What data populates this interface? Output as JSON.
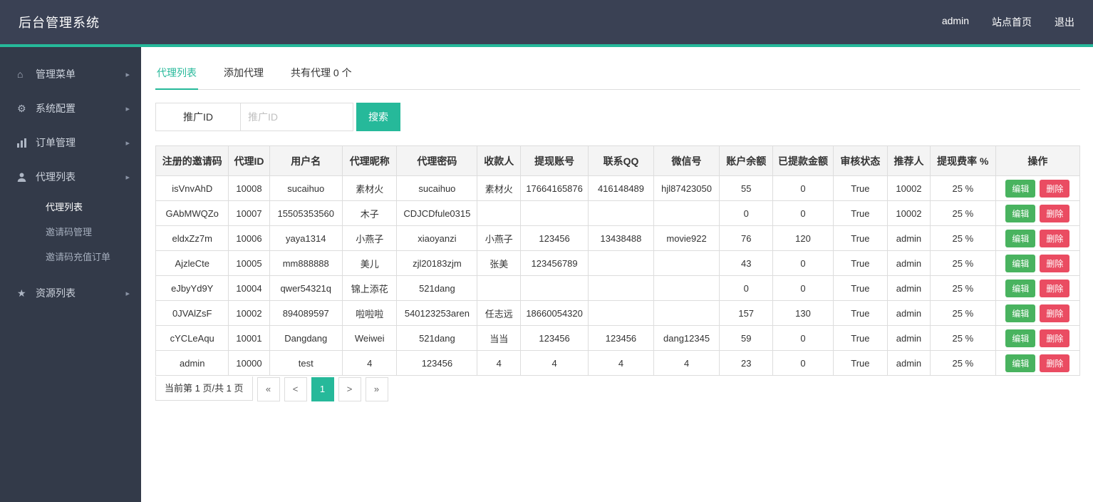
{
  "navbar": {
    "brand": "后台管理系统",
    "links": [
      {
        "label": "admin"
      },
      {
        "label": "站点首页"
      },
      {
        "label": "退出"
      }
    ]
  },
  "sidebar": {
    "items": [
      {
        "id": "admin-menu",
        "icon": "home-icon",
        "label": "管理菜单"
      },
      {
        "id": "system-config",
        "icon": "gears-icon",
        "label": "系统配置"
      },
      {
        "id": "order-management",
        "icon": "bar-chart-icon",
        "label": "订单管理"
      },
      {
        "id": "agent-list",
        "icon": "user-icon",
        "label": "代理列表",
        "children": [
          {
            "label": "代理列表",
            "active": true
          },
          {
            "label": "邀请码管理",
            "active": false
          },
          {
            "label": "邀请码充值订单",
            "active": false
          }
        ]
      },
      {
        "id": "resource-list",
        "icon": "star-icon",
        "label": "资源列表"
      }
    ]
  },
  "tabs": [
    {
      "id": "agent-list",
      "label": "代理列表",
      "active": true,
      "static": false
    },
    {
      "id": "add-agent",
      "label": "添加代理",
      "active": false,
      "static": false
    },
    {
      "id": "agent-count",
      "label": "共有代理 0 个",
      "active": false,
      "static": true
    }
  ],
  "search": {
    "field_label": "推广ID",
    "placeholder": "推广ID",
    "button_label": "搜索"
  },
  "table": {
    "headers": [
      "注册的邀请码",
      "代理ID",
      "用户名",
      "代理昵称",
      "代理密码",
      "收款人",
      "提现账号",
      "联系QQ",
      "微信号",
      "账户余额",
      "已提款金额",
      "审核状态",
      "推荐人",
      "提现费率 %",
      "操作"
    ],
    "rows": [
      [
        "isVnvAhD",
        "10008",
        "sucaihuo",
        "素材火",
        "sucaihuo",
        "素材火",
        "17664165876",
        "416148489",
        "hjl87423050",
        "55",
        "0",
        "True",
        "10002",
        "25 %"
      ],
      [
        "GAbMWQZo",
        "10007",
        "15505353560",
        "木子",
        "CDJCDfule0315",
        "",
        "",
        "",
        "",
        "0",
        "0",
        "True",
        "10002",
        "25 %"
      ],
      [
        "eldxZz7m",
        "10006",
        "yaya1314",
        "小燕子",
        "xiaoyanzi",
        "小燕子",
        "123456",
        "13438488",
        "movie922",
        "76",
        "120",
        "True",
        "admin",
        "25 %"
      ],
      [
        "AjzleCte",
        "10005",
        "mm888888",
        "美儿",
        "zjl20183zjm",
        "张美",
        "123456789",
        "",
        "",
        "43",
        "0",
        "True",
        "admin",
        "25 %"
      ],
      [
        "eJbyYd9Y",
        "10004",
        "qwer54321q",
        "锦上添花",
        "521dang",
        "",
        "",
        "",
        "",
        "0",
        "0",
        "True",
        "admin",
        "25 %"
      ],
      [
        "0JVAlZsF",
        "10002",
        "894089597",
        "啦啦啦",
        "540123253aren",
        "任志远",
        "18660054320",
        "",
        "",
        "157",
        "130",
        "True",
        "admin",
        "25 %"
      ],
      [
        "cYCLeAqu",
        "10001",
        "Dangdang",
        "Weiwei",
        "521dang",
        "当当",
        "123456",
        "123456",
        "dang12345",
        "59",
        "0",
        "True",
        "admin",
        "25 %"
      ],
      [
        "admin",
        "10000",
        "test",
        "4",
        "123456",
        "4",
        "4",
        "4",
        "4",
        "23",
        "0",
        "True",
        "admin",
        "25 %"
      ]
    ],
    "actions": {
      "edit": "编辑",
      "delete": "删除"
    }
  },
  "pagination": {
    "status": "当前第 1 页/共 1 页",
    "items": [
      {
        "id": "first",
        "label": "«",
        "active": false
      },
      {
        "id": "prev",
        "label": "<",
        "active": false
      },
      {
        "id": "page-1",
        "label": "1",
        "active": true
      },
      {
        "id": "next",
        "label": ">",
        "active": false
      },
      {
        "id": "last",
        "label": "»",
        "active": false
      }
    ]
  },
  "colors": {
    "accent_teal": "#26b99a",
    "navbar_bg": "#3a4154",
    "sidebar_bg": "#333a49",
    "edit_green": "#49b35f",
    "delete_red": "#ea4c62"
  }
}
